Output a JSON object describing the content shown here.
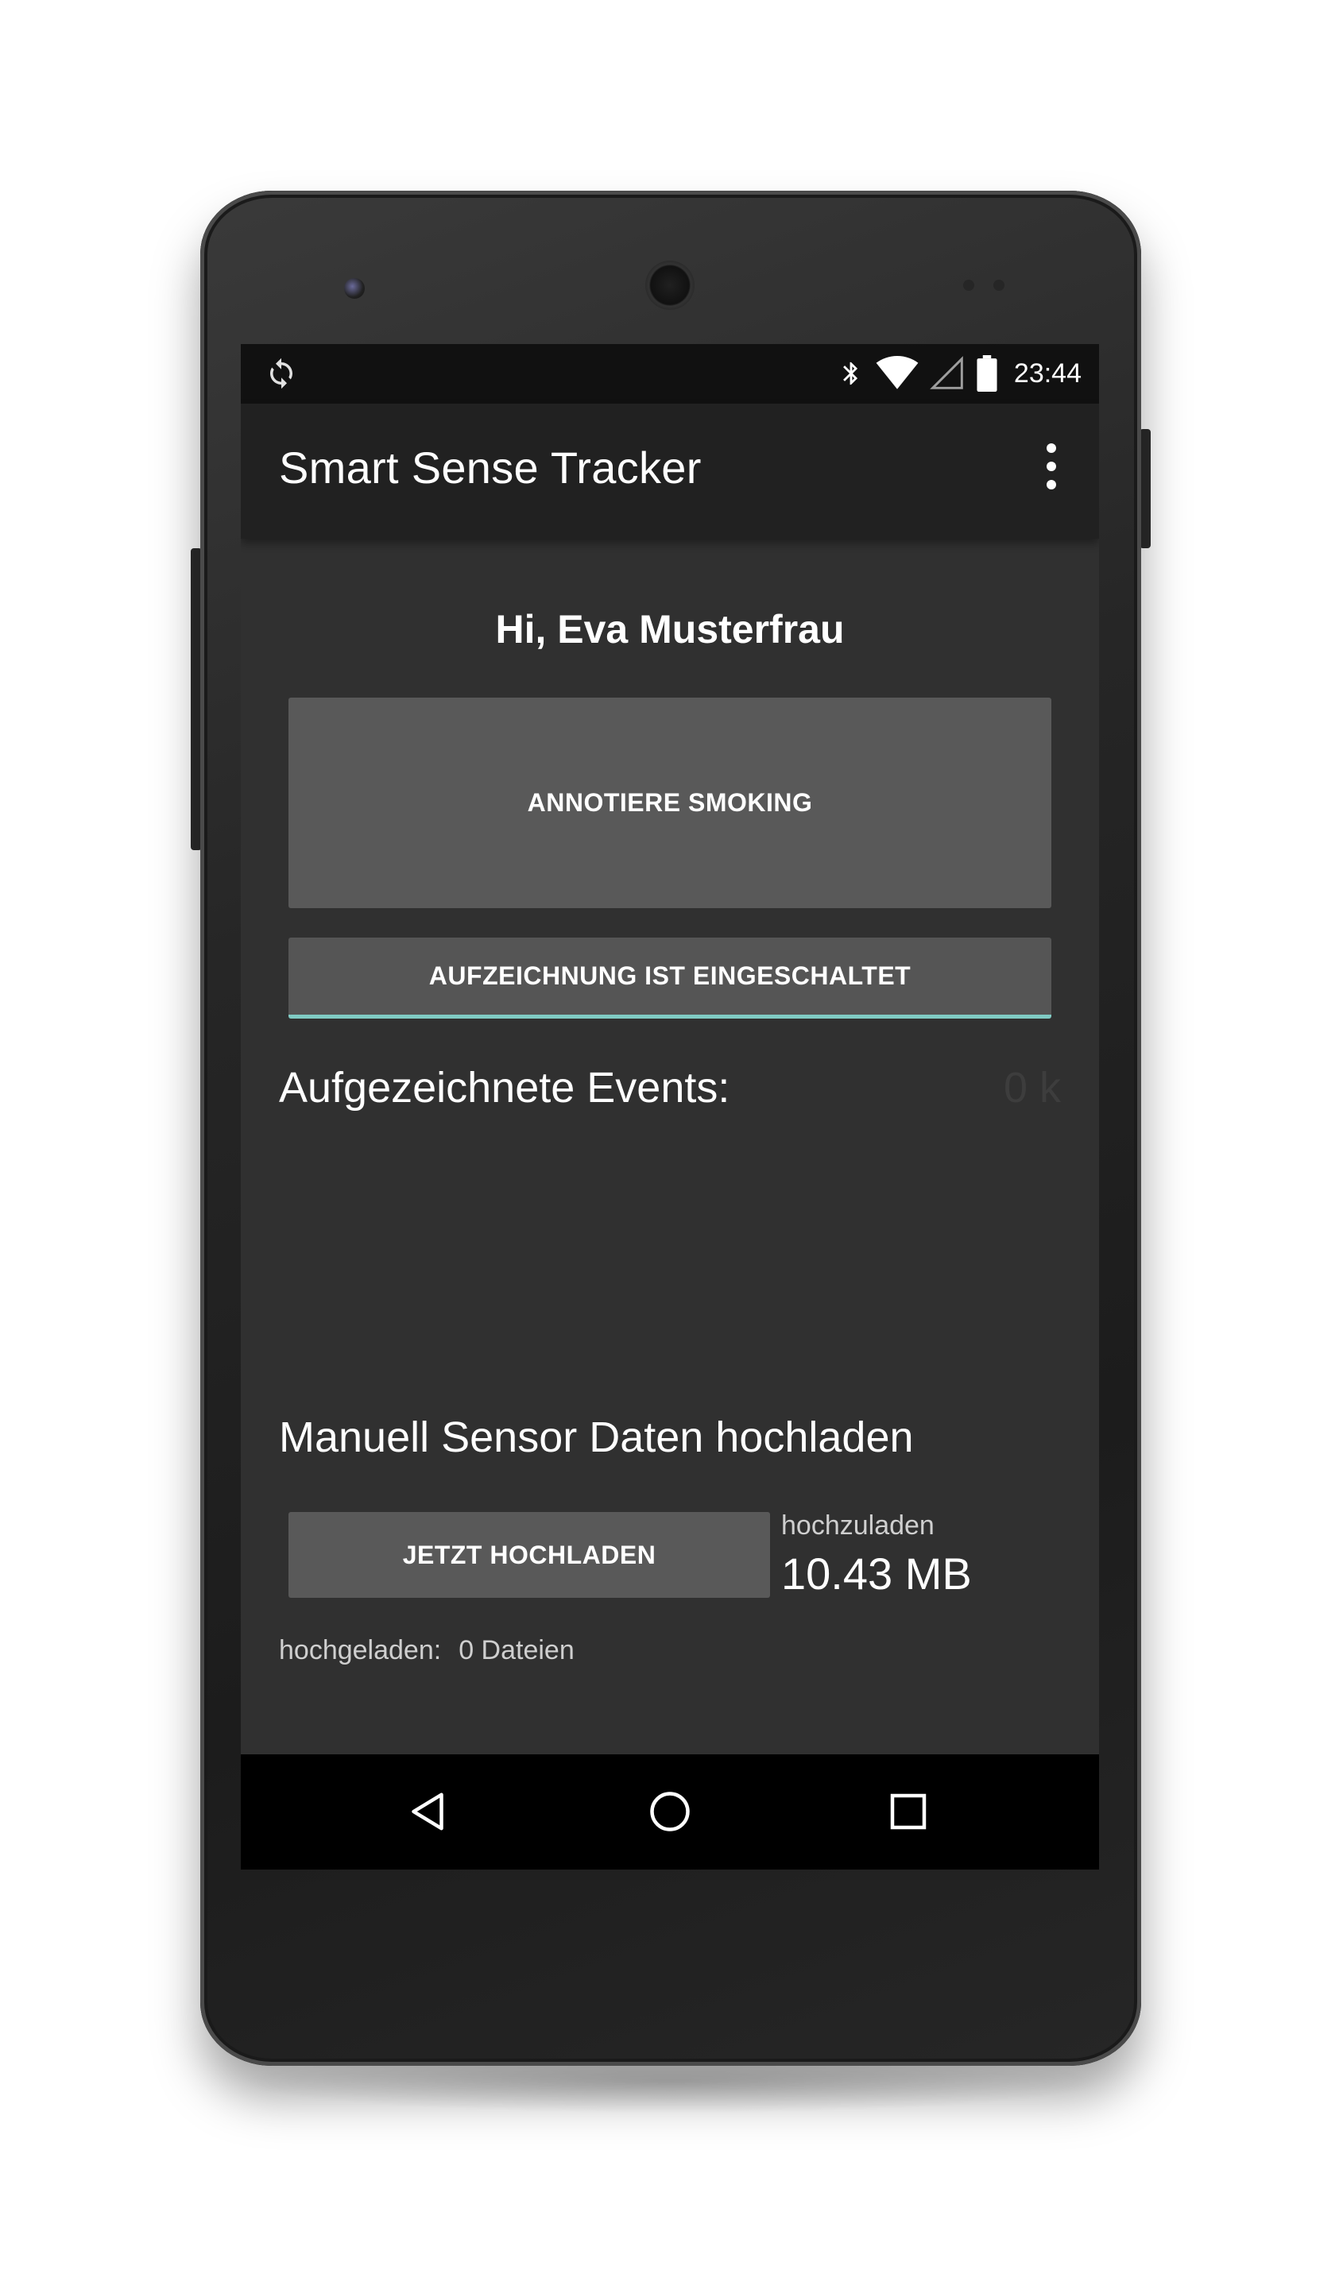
{
  "status_bar": {
    "time": "23:44",
    "left_icons": [
      "sync-icon"
    ],
    "right_icons": [
      "bluetooth-icon",
      "wifi-icon",
      "cell-signal-icon",
      "battery-icon"
    ]
  },
  "app_bar": {
    "title": "Smart Sense Tracker",
    "menu_icon": "overflow-menu-icon"
  },
  "main": {
    "greeting": "Hi, Eva Musterfrau",
    "annotate_button": "ANNOTIERE SMOKING",
    "recording_toggle": "AUFZEICHNUNG IST EINGESCHALTET",
    "events_label": "Aufgezeichnete Events:",
    "events_count": "0 k"
  },
  "upload": {
    "heading": "Manuell Sensor Daten hochladen",
    "button": "JETZT HOCHLADEN",
    "pending_label": "hochzuladen",
    "pending_value": "10.43 MB",
    "uploaded_label": "hochgeladen:",
    "uploaded_value": "0 Dateien"
  },
  "nav_bar": {
    "buttons": [
      "back-icon",
      "home-icon",
      "recents-icon"
    ]
  },
  "colors": {
    "screen_bg": "#303030",
    "app_bar": "#212121",
    "button_bg": "#595959",
    "accent": "#80cbc4",
    "nav_bar": "#000000"
  }
}
